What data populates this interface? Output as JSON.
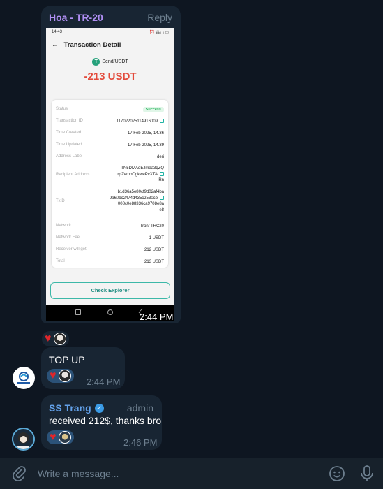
{
  "messages": {
    "photo": {
      "sender": "Hoa - TR-20",
      "reply_label": "Reply",
      "time": "2:44 PM",
      "screenshot": {
        "status_time": "14.43",
        "status_icons": "⏰ ⁂ᵢₗ ᵢₗ ▭",
        "header_title": "Transaction Detail",
        "coin_label": "Send/USDT",
        "amount": "-213 USDT",
        "status_label": "Status",
        "status_value": "Success",
        "rows": [
          {
            "k": "Transaction ID",
            "v": "117022025114916009"
          },
          {
            "k": "Time Created",
            "v": "17 Feb 2025, 14.36"
          },
          {
            "k": "Time Updated",
            "v": "17 Feb 2025, 14.39"
          },
          {
            "k": "Address Label",
            "v": "deri"
          },
          {
            "k": "Recipient Address",
            "v1": "TN5DMAdEJmaa3qZQ",
            "v2": "rp2VmoCgkwePvXTA",
            "v3": "Rn"
          },
          {
            "k": "TxID",
            "v1": "b1d36a5e80cf9d02af4ba",
            "v2": "9a60bc2474d435c2530cb",
            "v3": "008c0e88336ca9708e8a",
            "v4": "e8"
          },
          {
            "k": "Network",
            "v": "Tron/ TRC20"
          },
          {
            "k": "Network Fee",
            "v": "1 USDT"
          },
          {
            "k": "Receiver will get",
            "v": "212 USDT"
          },
          {
            "k": "Total",
            "v": "213 USDT"
          }
        ],
        "check_explorer": "Check Explorer"
      }
    },
    "topup": {
      "text": "TOP UP",
      "time": "2:44 PM"
    },
    "reply": {
      "sender": "SS Trang",
      "role": "admin",
      "text": "received 212$, thanks bro",
      "time": "2:46 PM"
    }
  },
  "composer": {
    "placeholder": "Write a message..."
  },
  "colors": {
    "background": "#0e1621",
    "bubble": "#182533",
    "sender_name": "#b190f5",
    "amount_red": "#e34a3b",
    "heart": "#e0262b"
  },
  "icons": [
    "attach-icon",
    "emoji-icon",
    "microphone-icon",
    "heart-icon",
    "verified-icon",
    "back-arrow-icon",
    "copy-icon",
    "tether-icon"
  ]
}
